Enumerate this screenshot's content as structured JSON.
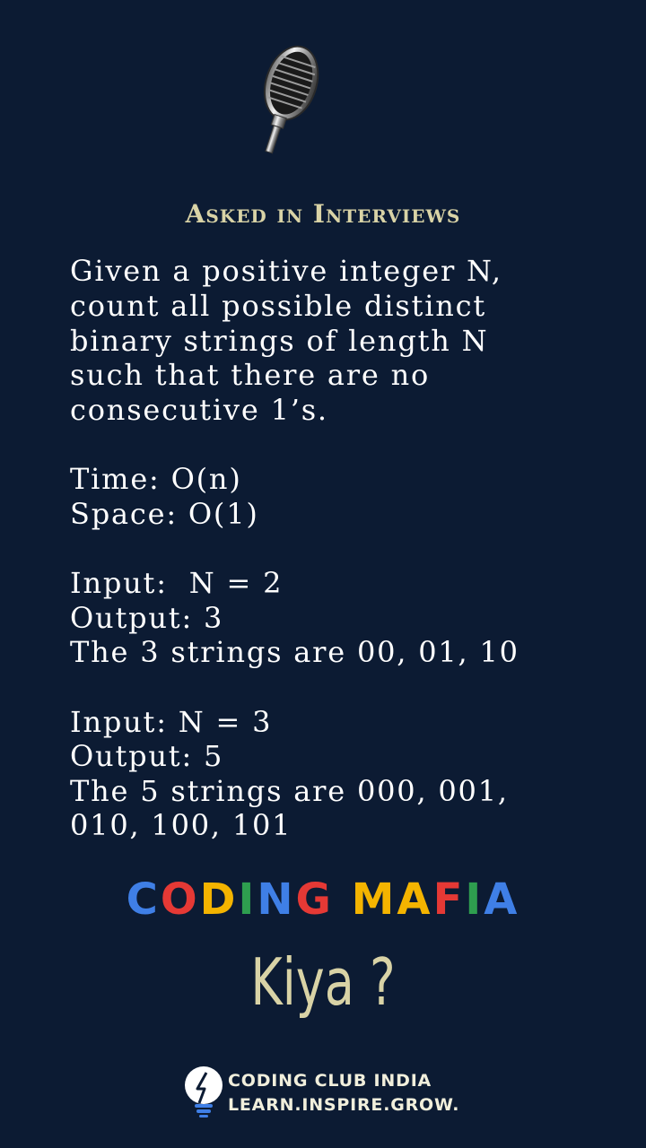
{
  "header": {
    "icon": "microphone-icon",
    "title": "Asked in Interviews"
  },
  "problem": {
    "statement": [
      "Given a positive integer N,",
      "count all possible distinct",
      "binary strings of length N",
      "such that there are no",
      "consecutive 1’s."
    ],
    "complexity": [
      "Time: O(n)",
      "Space: O(1)"
    ],
    "example1": [
      "Input:  N = 2",
      "Output: 3",
      "The 3 strings are 00, 01, 10"
    ],
    "example2": [
      "Input: N = 3",
      "Output: 5",
      "The 5 strings are 000, 001,",
      "010, 100, 101"
    ]
  },
  "brand": {
    "text": "CODING MAFIA",
    "letter_colors": [
      "#3f7fe6",
      "#e53935",
      "#f4b400",
      "#2e9e4f",
      "#3f7fe6",
      "#e53935",
      "#f4b400",
      "#f4b400",
      "#e53935",
      "#2e9e4f",
      "#3f7fe6",
      "#f4b400"
    ]
  },
  "tagline": "Kiya ?",
  "footer": {
    "icon": "lightbulb-icon",
    "line1": "CODING CLUB INDIA",
    "line2": "LEARN.INSPIRE.GROW."
  }
}
